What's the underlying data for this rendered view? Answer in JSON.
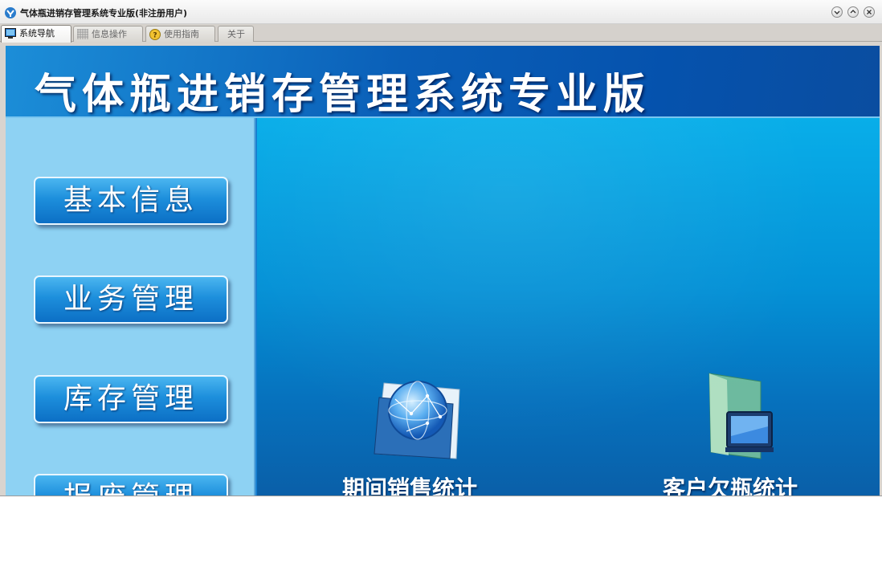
{
  "window": {
    "title": "气体瓶进销存管理系统专业版(非注册用户)",
    "controls": [
      "minimize",
      "maximize",
      "close"
    ]
  },
  "tabs": [
    {
      "label": "系统导航",
      "icon": "monitor-icon",
      "active": true
    },
    {
      "label": "信息操作",
      "icon": "grid-icon",
      "active": false
    },
    {
      "label": "使用指南",
      "icon": "help-icon",
      "active": false
    },
    {
      "label": "关于",
      "icon": "",
      "active": false
    }
  ],
  "banner": {
    "title": "气体瓶进销存管理系统专业版"
  },
  "sidebar": {
    "items": [
      {
        "label": "基本信息"
      },
      {
        "label": "业务管理"
      },
      {
        "label": "库存管理"
      },
      {
        "label": "报废管理"
      }
    ]
  },
  "main": {
    "tiles": [
      {
        "label": "期间销售统计",
        "icon": "globe-icon"
      },
      {
        "label": "客户欠瓶统计",
        "icon": "folder-monitor-icon"
      }
    ]
  },
  "colors": {
    "banner": "#0552ad",
    "sidebar": "#8ed2f3",
    "main_top": "#08aee9",
    "main_bottom": "#0a5fa8",
    "button": "#1d8fdc"
  }
}
